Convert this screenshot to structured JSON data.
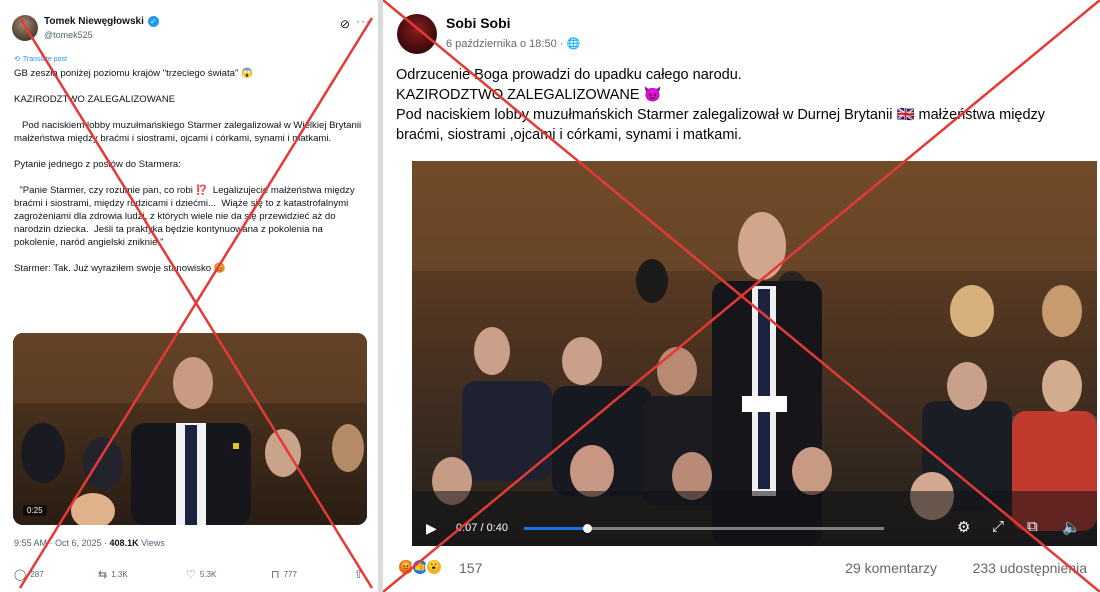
{
  "twitter_post": {
    "author_name": "Tomek Niewęgłowski",
    "verified_icon": "✓",
    "handle": "@tomek525",
    "grok_icon": "grok-icon",
    "more_icon": "more-icon",
    "translate_label": "Translate post",
    "paragraphs": [
      "GB zeszła poniżej poziomu krajów \"trzeciego świata\" 😱",
      "KAZIRODZTWO ZALEGALIZOWANE",
      "   Pod naciskiem lobby muzułmańskiego Starmer zalegalizował w Wielkiej Brytanii małżeństwa między braćmi i siostrami, ojcami i córkami, synami i matkami.",
      "Pytanie jednego z posłów do Starmera:",
      "  \"Panie Starmer, czy rozumie pan, co robi ⁉️  Legalizujecie małżeństwa między braćmi i siostrami, między rodzicami i dziećmi...  Wiąże się to z katastrofalnymi zagrożeniami dla zdrowia ludzi, z których wiele nie da się przewidzieć aż do narodzin dziecka.  Jeśli ta praktyka będzie kontynuowana z pokolenia na pokolenie, naród angielski zniknie.\"",
      "Starmer: Tak. Już wyraziłem swoje stanowisko 😡"
    ],
    "video_duration": "0:25",
    "timestamp": "9:55 AM · Oct 6, 2025 · ",
    "views_count": "408.1K",
    "views_label": " Views",
    "actions": {
      "replies": "287",
      "reposts": "1.3K",
      "likes": "5.3K",
      "bookmarks": "777"
    },
    "cross_color": "#e53935"
  },
  "facebook_post": {
    "author_name": "Sobi Sobi",
    "date": "6 października o 18:50 · ",
    "text_lines": [
      "Odrzucenie Boga prowadzi do upadku całego narodu.",
      "KAZIRODZTWO ZALEGALIZOWANE 😈",
      "Pod naciskiem lobby muzułmańskich Starmer zalegalizował w Durnej Brytanii 🇬🇧 małżeństwa między braćmi, siostrami ,ojcami i córkami, synami i matkami."
    ],
    "video": {
      "current_time": "0:07",
      "separator": " / ",
      "total_time": "0:40",
      "progress": 0.175
    },
    "reactions": {
      "icons": [
        "angry",
        "like",
        "wow"
      ],
      "count": "157",
      "comments": "29 komentarzy",
      "shares": "233 udostępnienia"
    },
    "cross_color": "#e53935"
  }
}
